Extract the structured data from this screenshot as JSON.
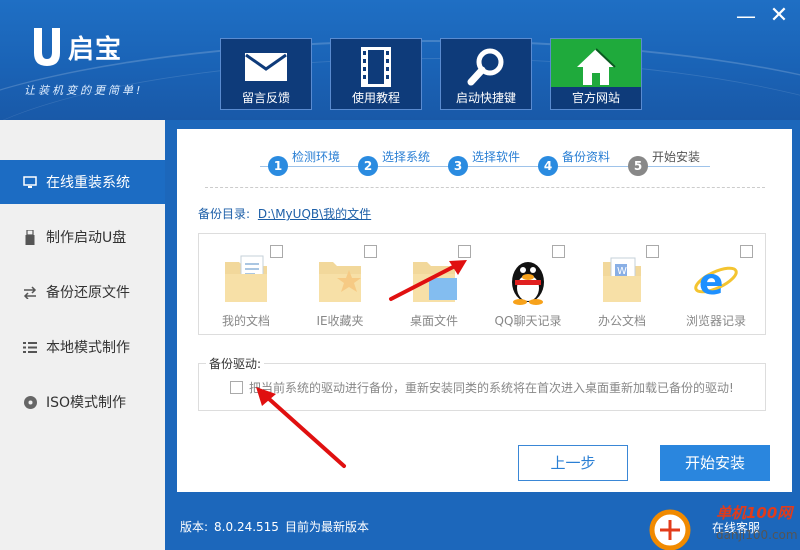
{
  "app": {
    "logo_letter": "U",
    "logo_name": "启宝",
    "slogan": "让装机变的更简单!"
  },
  "window": {
    "minimize_glyph": "—",
    "close_glyph": "✕"
  },
  "toolbar": [
    {
      "label": "留言反馈",
      "icon": "mail-icon"
    },
    {
      "label": "使用教程",
      "icon": "film-icon"
    },
    {
      "label": "启动快捷键",
      "icon": "search-icon"
    },
    {
      "label": "官方网站",
      "icon": "home-icon"
    }
  ],
  "sidebar": {
    "items": [
      {
        "label": "在线重装系统",
        "icon": "monitor-icon",
        "active": true
      },
      {
        "label": "制作启动U盘",
        "icon": "usb-icon"
      },
      {
        "label": "备份还原文件",
        "icon": "swap-icon"
      },
      {
        "label": "本地模式制作",
        "icon": "list-icon"
      },
      {
        "label": "ISO模式制作",
        "icon": "disc-icon"
      }
    ]
  },
  "steps": [
    {
      "num": "1",
      "label": "检测环境"
    },
    {
      "num": "2",
      "label": "选择系统"
    },
    {
      "num": "3",
      "label": "选择软件"
    },
    {
      "num": "4",
      "label": "备份资料"
    },
    {
      "num": "5",
      "label": "开始安装"
    }
  ],
  "backup": {
    "dir_label": "备份目录:",
    "dir_path": "D:\\MyUQB\\我的文件"
  },
  "files": [
    {
      "label": "我的文档",
      "icon": "documents-folder-icon"
    },
    {
      "label": "IE收藏夹",
      "icon": "favorites-folder-icon"
    },
    {
      "label": "桌面文件",
      "icon": "desktop-folder-icon"
    },
    {
      "label": "QQ聊天记录",
      "icon": "qq-penguin-icon"
    },
    {
      "label": "办公文档",
      "icon": "office-doc-icon"
    },
    {
      "label": "浏览器记录",
      "icon": "ie-browser-icon"
    }
  ],
  "driver": {
    "title": "备份驱动:",
    "text": "把当前系统的驱动进行备份，重新安装同类的系统将在首次进入桌面重新加载已备份的驱动!"
  },
  "buttons": {
    "prev": "上一步",
    "start": "开始安装"
  },
  "footer": {
    "version_label": "版本:",
    "version": "8.0.24.515",
    "status": "目前为最新版本",
    "online_service": "在线客服"
  },
  "watermark": {
    "line1": "单机100网",
    "line2": "danji100.com"
  },
  "colors": {
    "header": "#1f6fc4",
    "accent": "#2a86de",
    "sidebar_active": "#1c6cc3",
    "tile_green": "#1faa3c"
  }
}
